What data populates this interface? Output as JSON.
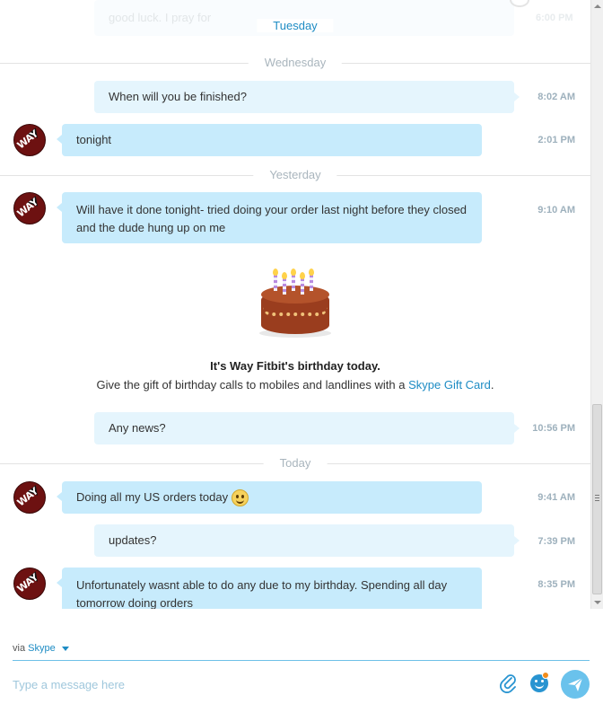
{
  "conversation": {
    "top_partial": {
      "text": "good luck. I pray for",
      "time": "6:00 PM"
    },
    "separators": {
      "tuesday": "Tuesday",
      "wednesday": "Wednesday",
      "yesterday": "Yesterday",
      "today": "Today"
    },
    "messages": [
      {
        "from": "me",
        "text": "When will you be finished?",
        "time": "8:02 AM"
      },
      {
        "from": "contact",
        "text": "tonight",
        "time": "2:01 PM"
      },
      {
        "from": "contact",
        "text": "Will have it done tonight- tried doing your order last night before they closed and the dude hung up on me",
        "time": "9:10 AM"
      },
      {
        "from": "me",
        "text": "Any news?",
        "time": "10:56 PM"
      },
      {
        "from": "contact",
        "text": "Doing all my US orders today",
        "time": "9:41 AM",
        "emoticon": "smile-icon"
      },
      {
        "from": "me",
        "text": "updates?",
        "time": "7:39 PM"
      },
      {
        "from": "contact",
        "text": "Unfortunately wasnt able to do any due to my birthday. Spending all day tomorrow doing orders",
        "time": "8:35 PM"
      }
    ],
    "avatar_text": "WAY",
    "birthday": {
      "icon": "birthday-cake-icon",
      "title": "It's Way Fitbit's birthday today.",
      "text_before": "Give the gift of birthday calls to mobiles and landlines with a ",
      "link": "Skype Gift Card",
      "text_after": "."
    }
  },
  "composer": {
    "via_label": "via",
    "via_service": "Skype",
    "placeholder": "Type a message here",
    "icons": [
      "paperclip-icon",
      "emoticon-icon",
      "send-icon"
    ]
  },
  "colors": {
    "accent": "#1e8cc4",
    "incoming_bubble": "#c7ebfc",
    "outgoing_bubble": "#e5f5fd",
    "send_button": "#6ac2ec"
  }
}
